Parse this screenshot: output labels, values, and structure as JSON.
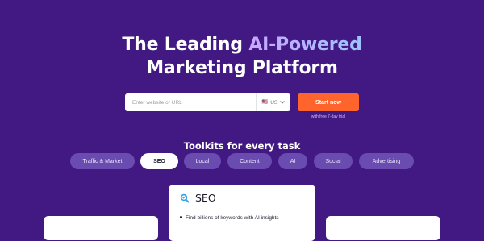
{
  "hero": {
    "title_part1": "The Leading ",
    "title_accent": "AI-Powered",
    "title_line2": "Marketing Platform"
  },
  "search": {
    "placeholder": "Enter website or URL",
    "country_flag": "🇺🇸",
    "country_code": "US",
    "start_label": "Start now",
    "trial_note": "with free 7-day trial"
  },
  "toolkits": {
    "heading": "Toolkits for every task",
    "tabs": [
      {
        "label": "Traffic & Market",
        "active": false
      },
      {
        "label": "SEO",
        "active": true
      },
      {
        "label": "Local",
        "active": false
      },
      {
        "label": "Content",
        "active": false
      },
      {
        "label": "AI",
        "active": false
      },
      {
        "label": "Social",
        "active": false
      },
      {
        "label": "Advertising",
        "active": false
      }
    ]
  },
  "card": {
    "title": "SEO",
    "icon": "seo-toolkit-icon",
    "bullets": [
      "Find billions of keywords with AI insights"
    ]
  },
  "colors": {
    "background": "#421983",
    "accent_orange": "#ff642d",
    "tab_inactive": "#6a4bb0",
    "tab_active": "#ffffff",
    "title_gradient_start": "#c9a7ff",
    "title_gradient_end": "#9fc3ff",
    "seo_icon_blue": "#2fa4e7"
  }
}
